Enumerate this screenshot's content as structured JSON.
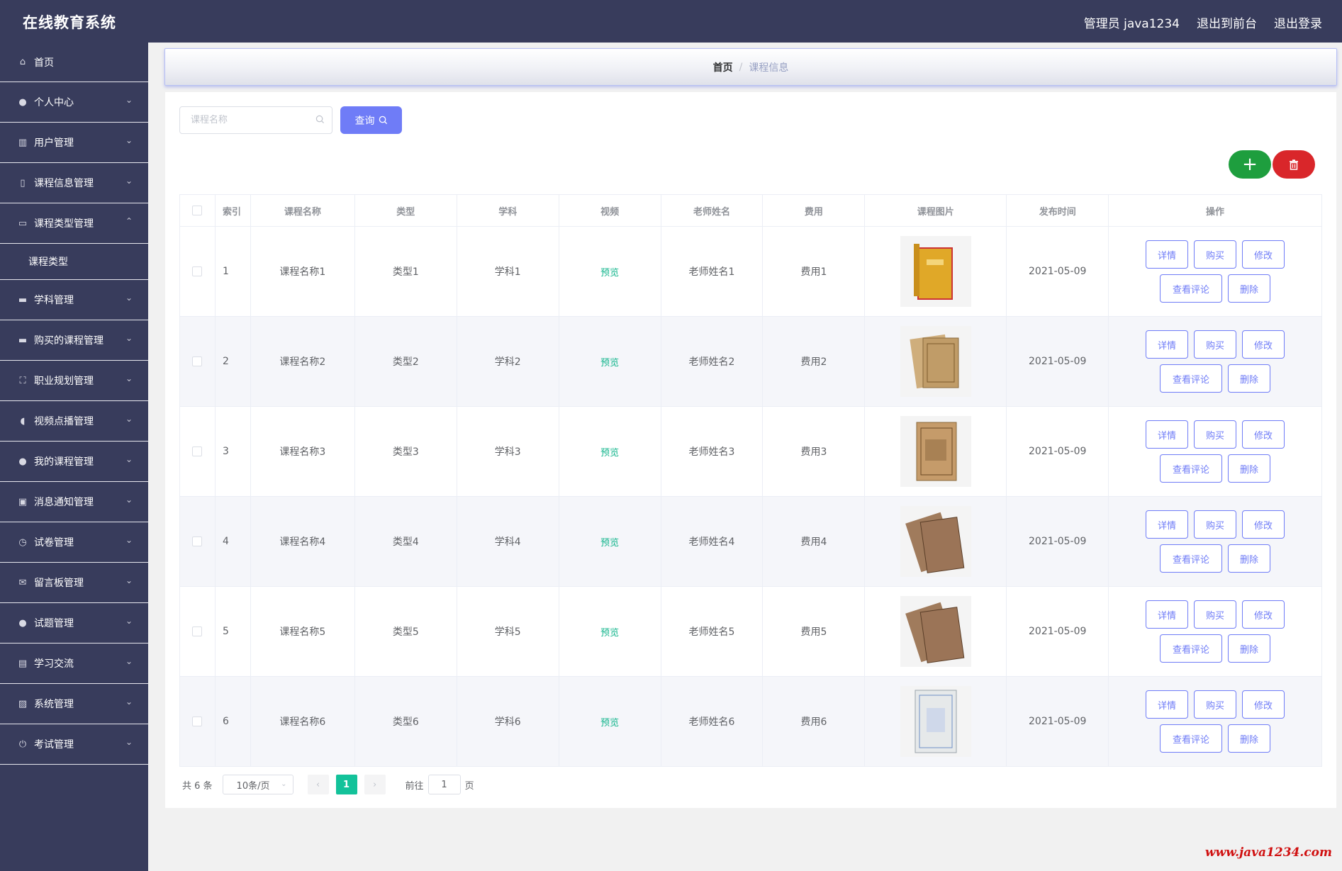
{
  "header": {
    "title": "在线教育系统",
    "user": "管理员 java1234",
    "front": "退出到前台",
    "logout": "退出登录"
  },
  "sidebar": {
    "items": [
      {
        "label": "首页",
        "icon": "home-icon",
        "glyph": "⌂"
      },
      {
        "label": "个人中心",
        "icon": "user-icon",
        "glyph": "●"
      },
      {
        "label": "用户管理",
        "icon": "bar-chart-icon",
        "glyph": "▥"
      },
      {
        "label": "课程信息管理",
        "icon": "phone-icon",
        "glyph": "▯"
      },
      {
        "label": "课程类型管理",
        "icon": "window-icon",
        "glyph": "▭"
      },
      {
        "label": "课程类型",
        "icon": "",
        "glyph": ""
      },
      {
        "label": "学科管理",
        "icon": "briefcase-icon",
        "glyph": "▬"
      },
      {
        "label": "购买的课程管理",
        "icon": "card-icon",
        "glyph": "▬"
      },
      {
        "label": "职业规划管理",
        "icon": "fullscreen-icon",
        "glyph": "⛶"
      },
      {
        "label": "视频点播管理",
        "icon": "microphone-icon",
        "glyph": "◖"
      },
      {
        "label": "我的课程管理",
        "icon": "pin-icon",
        "glyph": "●"
      },
      {
        "label": "消息通知管理",
        "icon": "notebook-icon",
        "glyph": "▣"
      },
      {
        "label": "试卷管理",
        "icon": "clock-icon",
        "glyph": "◷"
      },
      {
        "label": "留言板管理",
        "icon": "message-icon",
        "glyph": "✉"
      },
      {
        "label": "试题管理",
        "icon": "user-icon",
        "glyph": "●"
      },
      {
        "label": "学习交流",
        "icon": "document-icon",
        "glyph": "▤"
      },
      {
        "label": "系统管理",
        "icon": "chart-icon",
        "glyph": "▨"
      },
      {
        "label": "考试管理",
        "icon": "power-icon",
        "glyph": "⏻"
      }
    ]
  },
  "breadcrumb": {
    "home": "首页",
    "sep": "/",
    "current": "课程信息"
  },
  "search": {
    "placeholder": "课程名称",
    "button": "查询"
  },
  "table": {
    "headers": [
      "索引",
      "课程名称",
      "类型",
      "学科",
      "视频",
      "老师姓名",
      "费用",
      "课程图片",
      "发布时间",
      "操作"
    ],
    "rows": [
      {
        "index": "1",
        "name": "课程名称1",
        "type": "类型1",
        "subject": "学科1",
        "video": "预览",
        "teacher": "老师姓名1",
        "fee": "费用1",
        "time": "2021-05-09"
      },
      {
        "index": "2",
        "name": "课程名称2",
        "type": "类型2",
        "subject": "学科2",
        "video": "预览",
        "teacher": "老师姓名2",
        "fee": "费用2",
        "time": "2021-05-09"
      },
      {
        "index": "3",
        "name": "课程名称3",
        "type": "类型3",
        "subject": "学科3",
        "video": "预览",
        "teacher": "老师姓名3",
        "fee": "费用3",
        "time": "2021-05-09"
      },
      {
        "index": "4",
        "name": "课程名称4",
        "type": "类型4",
        "subject": "学科4",
        "video": "预览",
        "teacher": "老师姓名4",
        "fee": "费用4",
        "time": "2021-05-09"
      },
      {
        "index": "5",
        "name": "课程名称5",
        "type": "类型5",
        "subject": "学科5",
        "video": "预览",
        "teacher": "老师姓名5",
        "fee": "费用5",
        "time": "2021-05-09"
      },
      {
        "index": "6",
        "name": "课程名称6",
        "type": "类型6",
        "subject": "学科6",
        "video": "预览",
        "teacher": "老师姓名6",
        "fee": "费用6",
        "time": "2021-05-09"
      }
    ],
    "actions": {
      "detail": "详情",
      "buy": "购买",
      "edit": "修改",
      "comments": "查看评论",
      "delete": "删除"
    }
  },
  "pagination": {
    "total": "共 6 条",
    "page_size": "10条/页",
    "prev": "‹",
    "current_page": "1",
    "next": "›",
    "goto_label": "前往",
    "goto_value": "1",
    "goto_unit": "页"
  },
  "watermark": "www.java1234.com",
  "colors": {
    "sidebar": "#383c5c",
    "primary": "#6f7cf7",
    "add": "#1e9e3e",
    "delete": "#d9262a",
    "active_page": "#13c29a"
  }
}
